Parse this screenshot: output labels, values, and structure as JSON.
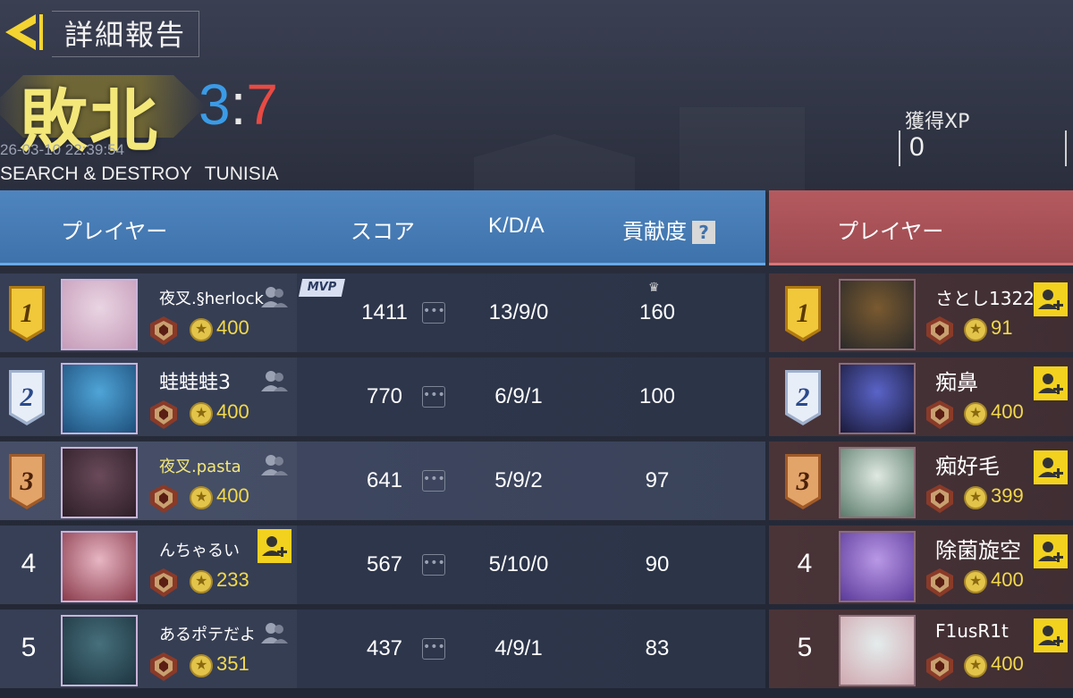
{
  "header": {
    "title": "詳細報告",
    "result": "敗北",
    "score_blue": "3",
    "score_sep": ":",
    "score_red": "7",
    "timestamp": "26-03-10 22:39:54",
    "mode": "SEARCH & DESTROY",
    "map": "TUNISIA",
    "xp_label": "獲得XP",
    "xp_value": "0"
  },
  "columns": {
    "player": "プレイヤー",
    "score": "スコア",
    "kda": "K/D/A",
    "contribution": "貢献度",
    "help": "?",
    "enemy_player": "プレイヤー"
  },
  "mvp_label": "MVP",
  "colors": {
    "blue_team": "#3e72ab",
    "red_team": "#9c4a50",
    "score_blue": "#3a9be6",
    "score_red": "#e84a43",
    "result_gold": "#f3e77a",
    "coin": "#e3c44a",
    "add_friend": "#f2d21e"
  },
  "blue_team": [
    {
      "rank": "1",
      "name": "夜叉.§herlock",
      "coins": "400",
      "score": "1411",
      "kda": "13/9/0",
      "contribution": "160"
    },
    {
      "rank": "2",
      "name": "蛙蛙蛙3",
      "coins": "400",
      "score": "770",
      "kda": "6/9/1",
      "contribution": "100"
    },
    {
      "rank": "3",
      "name": "夜叉.pasta",
      "coins": "400",
      "score": "641",
      "kda": "5/9/2",
      "contribution": "97"
    },
    {
      "rank": "4",
      "name": "んちゃるい",
      "coins": "233",
      "score": "567",
      "kda": "5/10/0",
      "contribution": "90"
    },
    {
      "rank": "5",
      "name": "あるポテだよ",
      "coins": "351",
      "score": "437",
      "kda": "4/9/1",
      "contribution": "83"
    }
  ],
  "red_team": [
    {
      "rank": "1",
      "name": "さとし1322",
      "coins": "91"
    },
    {
      "rank": "2",
      "name": "痴鼻",
      "coins": "400"
    },
    {
      "rank": "3",
      "name": "痴好毛",
      "coins": "399"
    },
    {
      "rank": "4",
      "name": "除菌旋空",
      "coins": "400"
    },
    {
      "rank": "5",
      "name": "F1usR1t",
      "coins": "400"
    }
  ],
  "icons": {
    "back": "back-arrow-icon",
    "rank_emblem": "rank-emblem-icon",
    "coin": "coin-star-icon",
    "friend": "friend-icon",
    "add_friend": "add-friend-icon",
    "crown": "crown-icon",
    "more": "more-dots-icon"
  }
}
